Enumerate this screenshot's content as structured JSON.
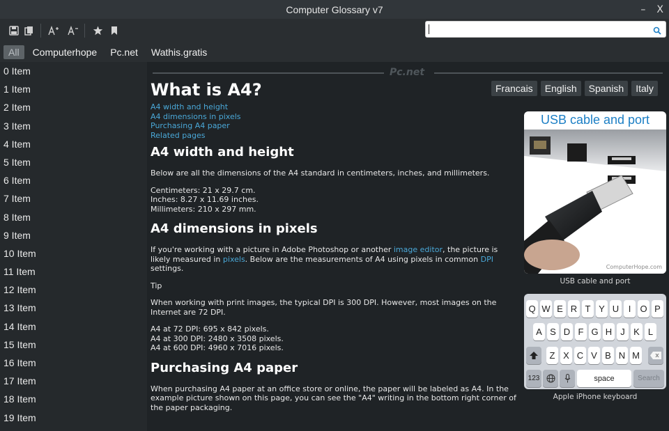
{
  "window": {
    "title": "Computer Glossary v7",
    "minimize": "–",
    "close": "X"
  },
  "toolbar": {
    "icons": [
      "save-icon",
      "copy-icon",
      "font-increase-icon",
      "font-decrease-icon",
      "star-icon",
      "bookmark-icon"
    ],
    "search": {
      "value": "",
      "icon": "search-icon"
    }
  },
  "tabs": [
    "All",
    "Computerhope",
    "Pc.net",
    "Wathis.gratis"
  ],
  "sidebar": {
    "items": [
      "0 Item",
      "1 Item",
      "2 Item",
      "3 Item",
      "4 Item",
      "5 Item",
      "6 Item",
      "7 Item",
      "8 Item",
      "9 Item",
      "10 Item",
      "11 Item",
      "12 Item",
      "13 Item",
      "14 Item",
      "15 Item",
      "16 Item",
      "17 Item",
      "18 Item",
      "19 Item"
    ]
  },
  "content": {
    "brand": "Pc.net",
    "title": "What is A4?",
    "languages": [
      "Francais",
      "English",
      "Spanish",
      "Italy"
    ],
    "toc": [
      "A4 width and height",
      "A4 dimensions in pixels",
      "Purchasing A4 paper",
      "Related pages"
    ],
    "s1": {
      "heading": "A4 width and height",
      "intro": "Below are all the dimensions of the A4 standard in centimeters, inches, and millimeters.",
      "dims": [
        "Centimeters: 21 x 29.7 cm.",
        "Inches: 8.27 x 11.69 inches.",
        "Millimeters: 210 x 297 mm."
      ]
    },
    "s2": {
      "heading": "A4 dimensions in pixels",
      "p1a": "If you're working with a picture in Adobe Photoshop or another ",
      "link1": "image editor",
      "p1b": ", the picture is likely measured in ",
      "link2": "pixels",
      "p1c": ". Below are the measurements of A4 using pixels in common ",
      "link3": "DPI",
      "p1d": " settings.",
      "tip": "Tip",
      "tiptext": "When working with print images, the typical DPI is 300 DPI. However, most images on the Internet are 72 DPI.",
      "dpi": [
        "A4 at 72 DPI: 695 x 842 pixels.",
        "A4 at 300 DPI: 2480 x 3508 pixels.",
        "A4 at 600 DPI: 4960 x 7016 pixels."
      ]
    },
    "s3": {
      "heading": "Purchasing A4 paper",
      "text": "When purchasing A4 paper at an office store or online, the paper will be labeled as A4. In the example picture shown on this page, you can see the \"A4\" writing in the bottom right corner of the paper packaging."
    },
    "figure1": {
      "title": "USB cable and port",
      "watermark": "ComputerHope.com",
      "caption": "USB cable and port"
    },
    "figure2": {
      "caption": "Apple iPhone keyboard",
      "row1": [
        "Q",
        "W",
        "E",
        "R",
        "T",
        "Y",
        "U",
        "I",
        "O",
        "P"
      ],
      "row2": [
        "A",
        "S",
        "D",
        "F",
        "G",
        "H",
        "J",
        "K",
        "L"
      ],
      "row3": [
        "Z",
        "X",
        "C",
        "V",
        "B",
        "N",
        "M"
      ],
      "num": "123",
      "space": "space",
      "search": "Search"
    }
  }
}
